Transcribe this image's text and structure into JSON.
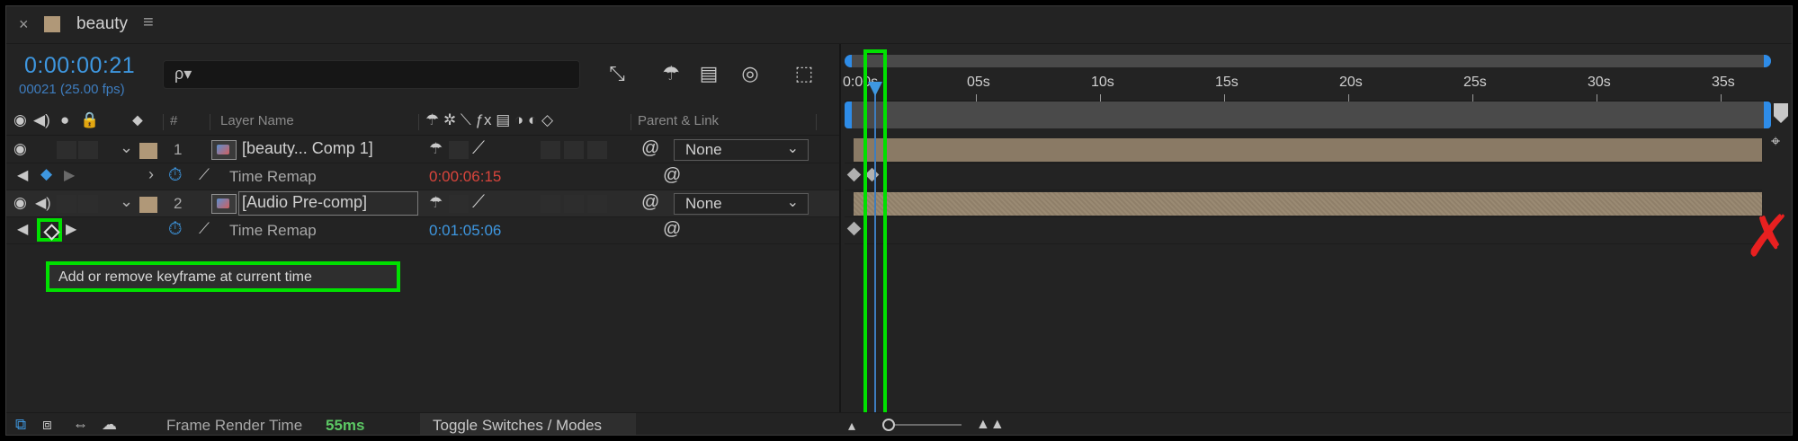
{
  "tab": {
    "close": "×",
    "title": "beauty",
    "menu": "≡",
    "swatch_color": "#b09878"
  },
  "header": {
    "timecode": "0:00:00:21",
    "frame_info": "00021 (25.00 fps)",
    "search_icon": "ρ▾"
  },
  "columns": {
    "hash": "#",
    "layer_name": "Layer Name",
    "parent_link": "Parent & Link"
  },
  "layers": [
    {
      "number": "1",
      "name": "[beauty... Comp 1]",
      "parent": "None"
    },
    {
      "number": "2",
      "name": "[Audio Pre-comp]",
      "parent": "None"
    }
  ],
  "properties": [
    {
      "name": "Time Remap",
      "value": "0:00:06:15",
      "value_color": "#d9453c"
    },
    {
      "name": "Time Remap",
      "value": "0:01:05:06",
      "value_color": "#3e97e0"
    }
  ],
  "tooltip": "Add or remove keyframe at current time",
  "ruler": {
    "labels": [
      "0:00s",
      "05s",
      "10s",
      "15s",
      "20s",
      "25s",
      "30s",
      "35s"
    ]
  },
  "bottom": {
    "frame_render_label": "Frame Render Time",
    "frame_render_value": "55ms",
    "toggle_label": "Toggle Switches / Modes"
  },
  "colors": {
    "accent": "#3e97e0",
    "highlight": "#00e000",
    "label": "#b09878",
    "error_mark": "#e82020"
  },
  "icons": [
    "eye-icon",
    "speaker-icon",
    "solo-icon",
    "lock-icon",
    "label-icon",
    "stopwatch-icon",
    "graph-icon",
    "shy-icon",
    "pickwhip-icon",
    "keyframe-icon"
  ]
}
